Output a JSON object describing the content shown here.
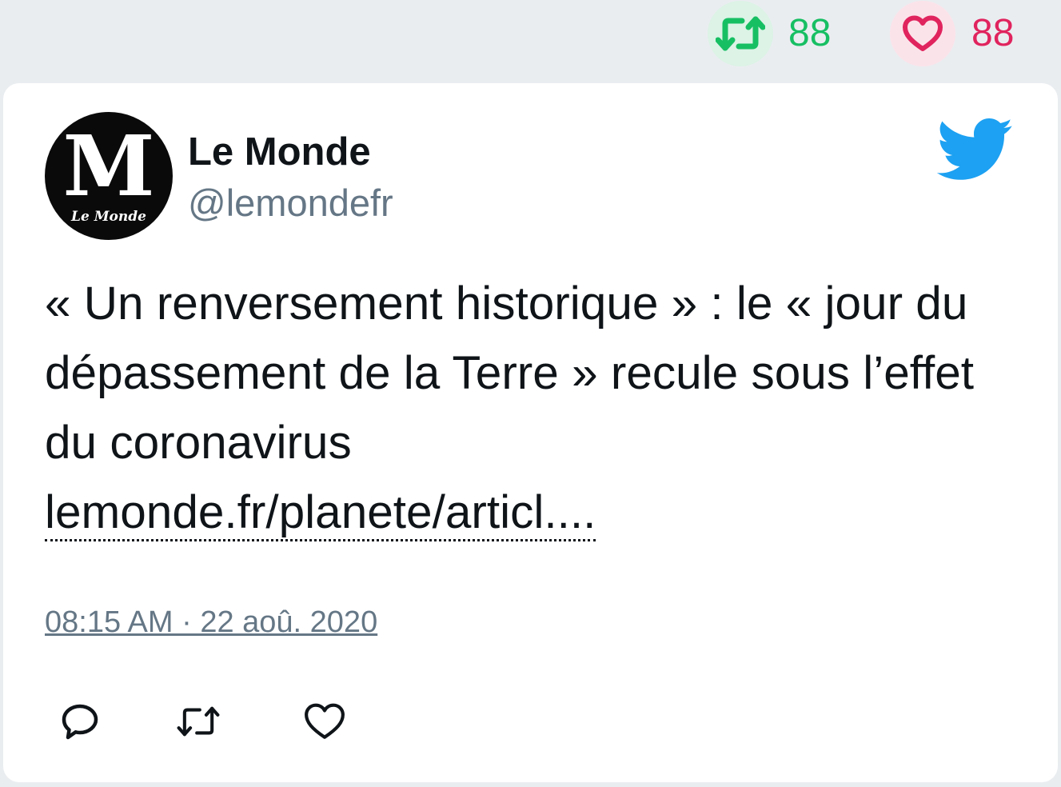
{
  "top_stats": {
    "retweet_count": "88",
    "like_count": "88"
  },
  "tweet": {
    "author_name": "Le Monde",
    "author_handle": "@lemondefr",
    "avatar_logo_text": "M",
    "avatar_caption": "Le Monde",
    "text": "« Un renversement historique » : le « jour du dépassement de la Terre » recule sous l’effet du coronavirus",
    "link_text": "lemonde.fr/planete/articl....",
    "timestamp": "08:15 AM · 22 aoû. 2020"
  },
  "icons": {
    "top_retweet": "retweet-icon",
    "top_like": "heart-icon",
    "brand": "twitter-bird-icon",
    "reply": "reply-icon",
    "retweet": "retweet-icon",
    "like": "heart-icon"
  },
  "colors": {
    "retweet_green": "#17bf63",
    "like_red": "#e0245e",
    "twitter_blue": "#1da1f2",
    "muted_gray": "#657786"
  }
}
